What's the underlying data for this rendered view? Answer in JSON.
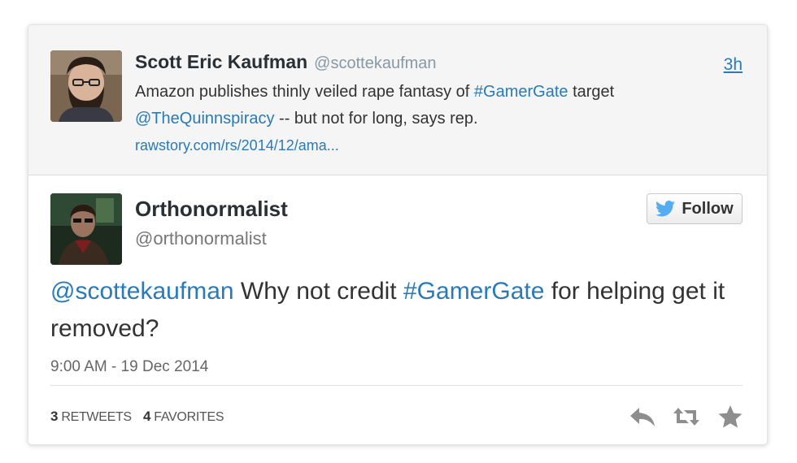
{
  "parent_tweet": {
    "author_name": "Scott Eric Kaufman",
    "author_handle": "@scottekaufman",
    "time": "3h",
    "text_1": "Amazon publishes thinly veiled rape fantasy of",
    "hashtag": "#GamerGate",
    "text_2": "target",
    "mention": "@TheQuinnspiracy",
    "text_3": "-- but not for long, says rep.",
    "link": "rawstory.com/rs/2014/12/ama..."
  },
  "tweet": {
    "author_name": "Orthonormalist",
    "author_handle": "@orthonormalist",
    "follow_label": "Follow",
    "mention": "@scottekaufman",
    "text_1": "Why not credit",
    "hashtag": "#GamerGate",
    "text_2": "for helping get it removed?",
    "timestamp": "9:00 AM - 19 Dec 2014",
    "retweets_count": "3",
    "retweets_label": "RETWEETS",
    "favorites_count": "4",
    "favorites_label": "FAVORITES"
  },
  "icons": {
    "twitter_bird": "twitter-bird-icon",
    "reply": "reply-icon",
    "retweet": "retweet-icon",
    "favorite": "star-icon"
  },
  "colors": {
    "link": "#2a7ab7",
    "twitter_blue": "#55acee",
    "action_icon": "#8e8e8e",
    "parent_bg": "#f5f5f5"
  }
}
